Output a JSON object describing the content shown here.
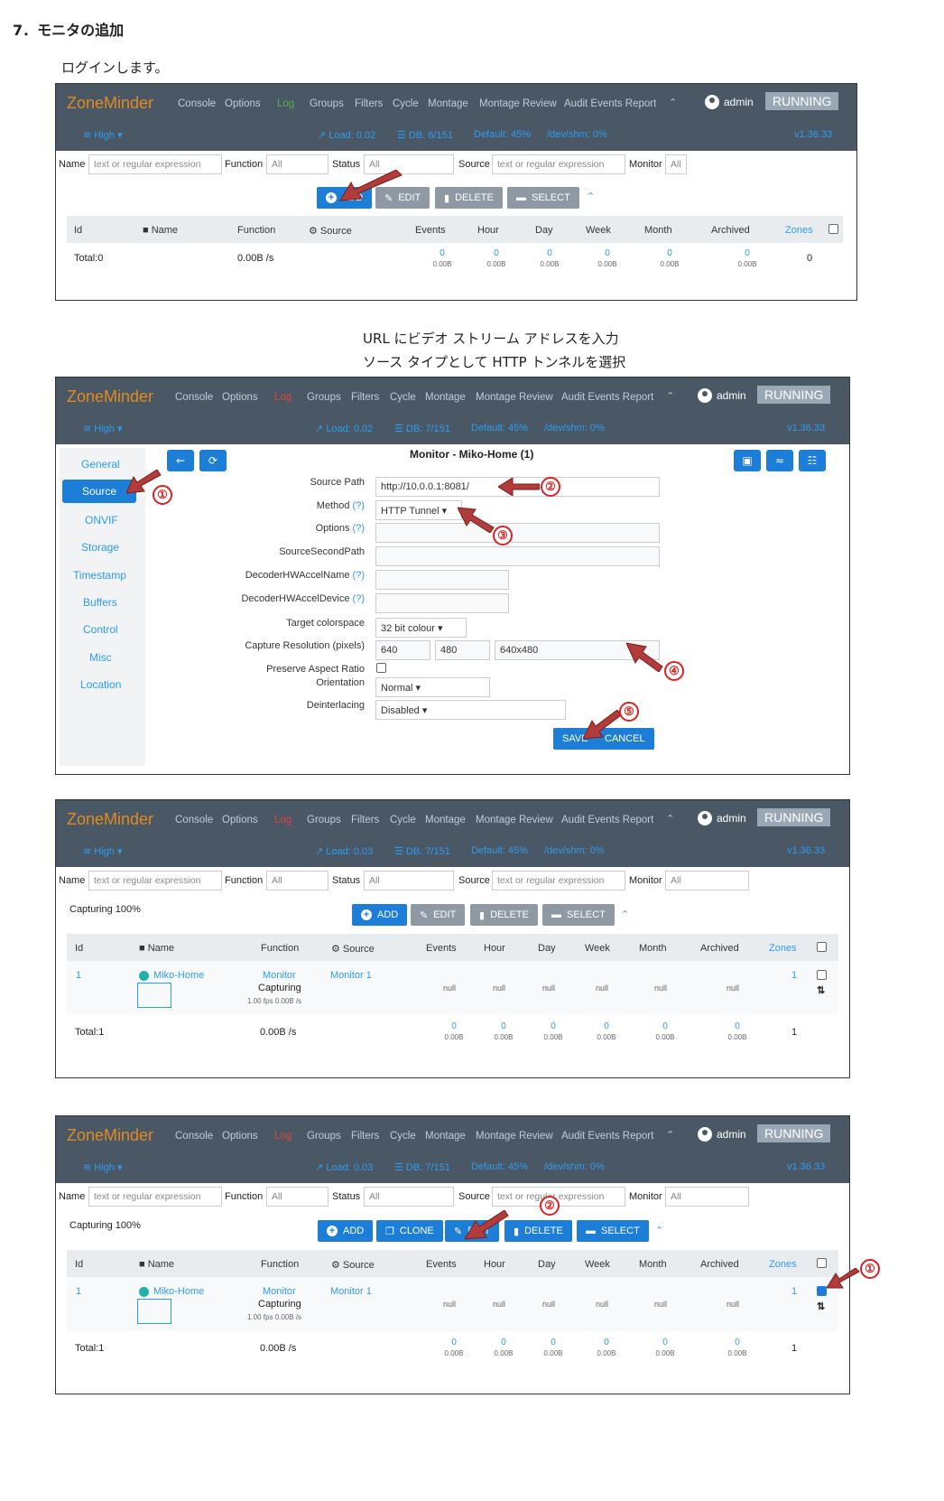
{
  "heading": "7．モニタの追加",
  "captions": {
    "login": "ログインします。",
    "url_line1": "URL にビデオ ストリーム アドレスを入力",
    "url_line2": "ソース タイプとして HTTP トンネルを選択"
  },
  "zm": {
    "logo": "ZoneMinder",
    "nav": [
      "Console",
      "Options",
      "Log",
      "Groups",
      "Filters",
      "Cycle",
      "Montage",
      "Montage Review",
      "Audit Events Report"
    ],
    "chevron_up": "⌃",
    "admin": "admin",
    "state": "RUNNING",
    "bandwidth": "High",
    "version": "v1.36.33",
    "default": "Default: 45%",
    "shm": "/dev/shm: 0%"
  },
  "shot1": {
    "load": "Load: 0.02",
    "db": "DB: 6/151"
  },
  "shot2": {
    "load": "Load: 0.02",
    "db": "DB: 7/151"
  },
  "shot3": {
    "load": "Load: 0.03",
    "db": "DB: 7/151"
  },
  "shot4": {
    "load": "Load: 0.03",
    "db": "DB: 7/151"
  },
  "filters": {
    "name_label": "Name",
    "name_placeholder": "text or regular expression",
    "function_label": "Function",
    "function_value": "All",
    "status_label": "Status",
    "status_value": "All",
    "source_label": "Source",
    "source_placeholder": "text or regular expression",
    "monitor_label": "Monitor",
    "monitor_value": "All"
  },
  "buttons": {
    "add": "ADD",
    "edit": "EDIT",
    "delete": "DELETE",
    "select": "SELECT",
    "clone": "CLONE",
    "save": "SAVE",
    "cancel": "CANCEL"
  },
  "table": {
    "headers": [
      "Id",
      "Name",
      "Function",
      "Source",
      "Events",
      "Hour",
      "Day",
      "Week",
      "Month",
      "Archived",
      "Zones"
    ],
    "total0": "Total:0",
    "total1": "Total:1",
    "bw": "0.00B /s",
    "zero": "0",
    "zero_size": "0.00B",
    "null": "null",
    "capturing_pct": "Capturing 100%",
    "row": {
      "id": "1",
      "name": "Miko-Home",
      "function": "Monitor",
      "status": "Capturing",
      "fps": "1.00 fps 0.00B /s",
      "source": "Monitor 1",
      "zones": "1",
      "total_zones": "1"
    }
  },
  "monitor_form": {
    "title": "Monitor - Miko-Home (1)",
    "tabs": [
      "General",
      "Source",
      "ONVIF",
      "Storage",
      "Timestamp",
      "Buffers",
      "Control",
      "Misc",
      "Location"
    ],
    "labels": {
      "source_path": "Source Path",
      "method": "Method",
      "options": "Options",
      "second_path": "SourceSecondPath",
      "hw_accel_name": "DecoderHWAccelName",
      "hw_accel_device": "DecoderHWAccelDevice",
      "colorspace": "Target colorspace",
      "capture_res": "Capture Resolution (pixels)",
      "aspect": "Preserve Aspect Ratio",
      "orientation": "Orientation",
      "deinterlacing": "Deinterlacing"
    },
    "help_mark": "(?)",
    "values": {
      "source_path": "http://10.0.0.1:8081/",
      "method": "HTTP Tunnel",
      "colorspace": "32 bit colour",
      "width": "640",
      "height": "480",
      "preset": "640x480",
      "orientation": "Normal",
      "deinterlacing": "Disabled"
    }
  },
  "markers": [
    "①",
    "②",
    "③",
    "④",
    "⑤"
  ]
}
